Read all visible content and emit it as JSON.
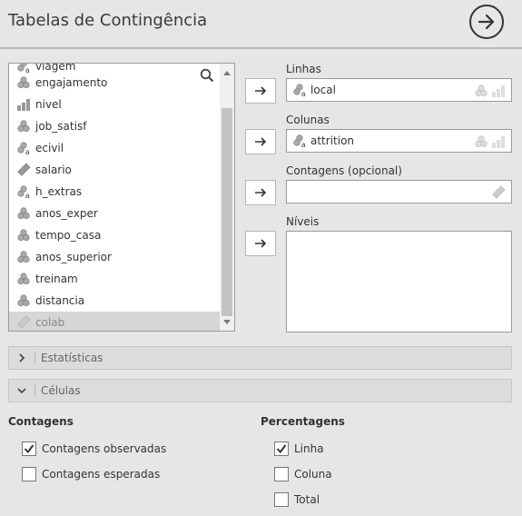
{
  "header": {
    "title": "Tabelas de Contingência"
  },
  "variables": [
    {
      "label": "viagem",
      "icon": "nominal-text-icon"
    },
    {
      "label": "engajamento",
      "icon": "nominal-icon"
    },
    {
      "label": "nivel",
      "icon": "ordinal-icon"
    },
    {
      "label": "job_satisf",
      "icon": "nominal-icon"
    },
    {
      "label": "ecivil",
      "icon": "nominal-text-icon"
    },
    {
      "label": "salario",
      "icon": "continuous-icon"
    },
    {
      "label": "h_extras",
      "icon": "nominal-text-icon"
    },
    {
      "label": "anos_exper",
      "icon": "nominal-icon"
    },
    {
      "label": "tempo_casa",
      "icon": "nominal-icon"
    },
    {
      "label": "anos_superior",
      "icon": "nominal-icon"
    },
    {
      "label": "treinam",
      "icon": "nominal-icon"
    },
    {
      "label": "distancia",
      "icon": "nominal-icon"
    },
    {
      "label": "colab",
      "icon": "id-icon"
    }
  ],
  "targets": {
    "linhas": {
      "label": "Linhas",
      "value": "local"
    },
    "colunas": {
      "label": "Colunas",
      "value": "attrition"
    },
    "contagens": {
      "label": "Contagens (opcional)",
      "value": ""
    },
    "niveis": {
      "label": "Níveis"
    }
  },
  "sections": {
    "estatisticas": "Estatísticas",
    "celulas": "Células"
  },
  "contagens_group": {
    "title": "Contagens",
    "options": [
      {
        "label": "Contagens observadas",
        "checked": true
      },
      {
        "label": "Contagens esperadas",
        "checked": false
      }
    ]
  },
  "percentagens_group": {
    "title": "Percentagens",
    "options": [
      {
        "label": "Linha",
        "checked": true
      },
      {
        "label": "Coluna",
        "checked": false
      },
      {
        "label": "Total",
        "checked": false
      }
    ]
  },
  "colors": {
    "background": "#e6e6e6",
    "panel": "#ffffff",
    "selected": "#d6d6d6"
  }
}
